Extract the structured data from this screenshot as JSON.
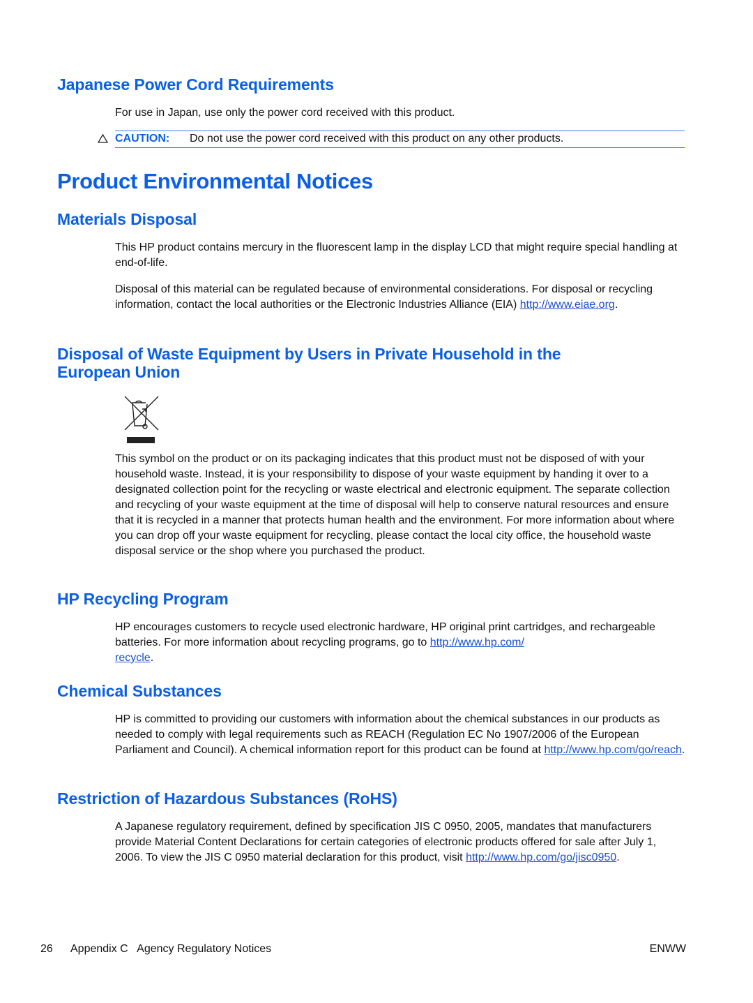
{
  "sections": {
    "japanese_power_cord": {
      "heading": "Japanese Power Cord Requirements",
      "body": "For use in Japan, use only the power cord received with this product.",
      "caution": {
        "icon": "caution-triangle-icon",
        "label": "CAUTION:",
        "text": "Do not use the power cord received with this product on any other products."
      }
    },
    "product_environmental_notices": {
      "title": "Product Environmental Notices"
    },
    "materials_disposal": {
      "heading": "Materials Disposal",
      "para1": "This HP product contains mercury in the fluorescent lamp in the display LCD that might require special handling at end-of-life.",
      "para2_text": "Disposal of this material can be regulated because of environmental considerations. For disposal or recycling information, contact the local authorities or the Electronic Industries Alliance (EIA) ",
      "para2_link": "http://www.eiae.org",
      "para2_end": "."
    },
    "weee": {
      "heading_line1": "Disposal of Waste Equipment by Users in Private Household in the",
      "heading_line2": "European Union",
      "icon": "crossed-out-wheelie-bin-icon",
      "body": "This symbol on the product or on its packaging indicates that this product must not be disposed of with your household waste. Instead, it is your responsibility to dispose of your waste equipment by handing it over to a designated collection point for the recycling or waste electrical and electronic equipment. The separate collection and recycling of your waste equipment at the time of disposal will help to conserve natural resources and ensure that it is recycled in a manner that protects human health and the environment. For more information about where you can drop off your waste equipment for recycling, please contact the local city office, the household waste disposal service or the shop where you purchased the product."
    },
    "hp_recycling": {
      "heading": "HP Recycling Program",
      "text": "HP encourages customers to recycle used electronic hardware, HP original print cartridges, and rechargeable batteries. For more information about recycling programs, go to ",
      "link": "http://www.hp.com/recycle",
      "link_display_1": "http://www.hp.com/",
      "link_display_2": "recycle",
      "end": "."
    },
    "chemical_substances": {
      "heading": "Chemical Substances",
      "text": "HP is committed to providing our customers with information about the chemical substances in our products as needed to comply with legal requirements such as REACH (Regulation EC No 1907/2006 of the European Parliament and Council). A chemical information report for this product can be found at ",
      "link": "http://www.hp.com/go/reach",
      "end": "."
    },
    "rohs": {
      "heading": "Restriction of Hazardous Substances (RoHS)",
      "text": "A Japanese regulatory requirement, defined by specification JIS C 0950, 2005, mandates that manufacturers provide Material Content Declarations for certain categories of electronic products offered for sale after July 1, 2006. To view the JIS C 0950 material declaration for this product, visit ",
      "link": "http://www.hp.com/go/jisc0950",
      "end": "."
    }
  },
  "footer": {
    "page_number": "26",
    "chapter": "Appendix C   Agency Regulatory Notices",
    "locale": "ENWW"
  },
  "colors": {
    "heading_blue": "#0a5fe6",
    "link_blue": "#1a4fd0",
    "rule_blue": "#3a7ee8"
  }
}
